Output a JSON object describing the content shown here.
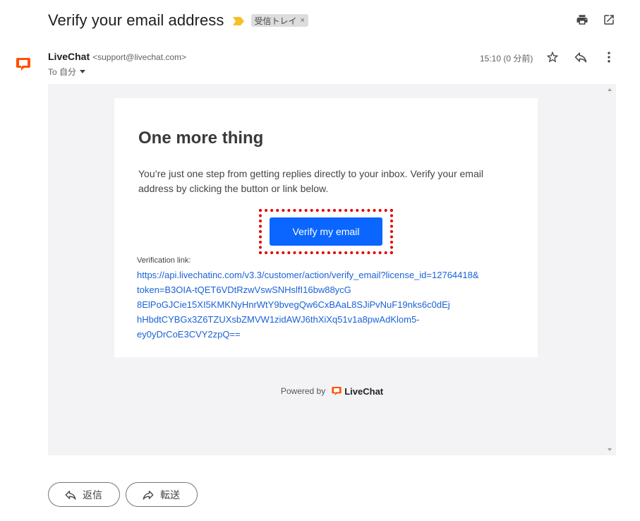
{
  "header": {
    "subject": "Verify your email address",
    "label": "受信トレイ",
    "label_remove": "×",
    "importance_color": "#f6c026",
    "icons": [
      "print-icon",
      "open-in-new-window-icon"
    ]
  },
  "sender": {
    "name": "LiveChat",
    "email": "<support@livechat.com>",
    "to": "To 自分",
    "time": "15:10 (0 分前)",
    "avatar_color": "#ff5100",
    "icons": [
      "star-icon",
      "reply-icon",
      "more-vert-icon"
    ]
  },
  "email": {
    "heading": "One more thing",
    "body": "You’re just one step from getting replies directly to your inbox. Verify your email address by clicking the button or link below.",
    "button_label": "Verify my email",
    "button_color": "#0a66ff",
    "link_label": "Verification link:",
    "link_lines": [
      "https://api.livechatinc.com/v3.3/customer/action/verify_email?license_id=12764418&",
      "token=B3OIA-tQET6VDtRzwVswSNHslfI16bw88ycG",
      "8ElPoGJCie15XI5KMKNyHnrWtY9bvegQw6CxBAaL8SJiPvNuF19nks6c0dEj",
      "hHbdtCYBGx3Z6TZUXsbZMVW1zidAWJ6thXiXq51v1a8pwAdKlom5-",
      "ey0yDrCoE3CVY2zpQ=="
    ],
    "powered_by": "Powered by",
    "powered_brand": "LiveChat"
  },
  "actions": {
    "reply": "返信",
    "forward": "転送"
  }
}
